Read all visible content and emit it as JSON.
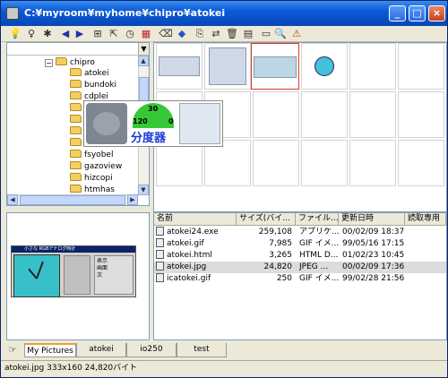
{
  "window": {
    "title": "C:¥myroom¥myhome¥chipro¥atokei"
  },
  "titlebar_buttons": {
    "minimize": "_",
    "maximize": "□",
    "close": "×"
  },
  "toolbar": {
    "icons": [
      "bulb-icon",
      "bulb-outline-icon",
      "sun-icon",
      "back-arrow-icon",
      "forward-arrow-icon",
      "folder-tree-icon",
      "shortcut-icon",
      "clock-icon",
      "calendar-icon",
      "eraser-icon",
      "tag-icon",
      "copy-icon",
      "move-icon",
      "delete-icon",
      "properties-icon",
      "slideshow-icon",
      "zoom-icon",
      "warning-icon"
    ],
    "glyphs": [
      "💡",
      "♀",
      "✱",
      "◀",
      "▶",
      "⊞",
      "⇱",
      "◷",
      "▦",
      "⌫",
      "◆",
      "⎘",
      "⇄",
      "🗑",
      "▤",
      "▭",
      "🔍",
      "⚠"
    ]
  },
  "tree": {
    "items": [
      {
        "label": "chipro",
        "expanded": true
      },
      {
        "label": "atokei"
      },
      {
        "label": "bundoki"
      },
      {
        "label": "cdplei"
      },
      {
        "label": "fsyobel"
      },
      {
        "label": "gazoview"
      },
      {
        "label": "hizcopi"
      },
      {
        "label": "htmhas"
      }
    ]
  },
  "hover_tooltip": {
    "dial_top": "30",
    "dial_left": "120",
    "dial_right": "0",
    "caption": "分度器"
  },
  "preview": {
    "mini_title": "小さな RGBアナログ時計",
    "options": [
      "表示",
      "画面",
      "次"
    ]
  },
  "file_list": {
    "columns": [
      "名前",
      "サイズ(バイ...",
      "ファイル...",
      "更新日時",
      "読取専用"
    ],
    "rows": [
      {
        "name": "atokei24.exe",
        "size": "259,108",
        "type": "アプリケ...",
        "date": "00/02/09 18:37",
        "selected": false
      },
      {
        "name": "atokei.gif",
        "size": "7,985",
        "type": "GIF イメ...",
        "date": "99/05/16 17:15",
        "selected": false
      },
      {
        "name": "atokei.html",
        "size": "3,265",
        "type": "HTML D...",
        "date": "01/02/23 10:45",
        "selected": false
      },
      {
        "name": "atokei.jpg",
        "size": "24,820",
        "type": "JPEG ...",
        "date": "00/02/09 17:36",
        "selected": true
      },
      {
        "name": "icatokei.gif",
        "size": "250",
        "type": "GIF イメ...",
        "date": "99/02/28 21:56",
        "selected": false
      }
    ]
  },
  "tabs": [
    "My Pictures",
    "atokei",
    "io250",
    "test"
  ],
  "status": "atokei.jpg 333x160 24,820バイト"
}
